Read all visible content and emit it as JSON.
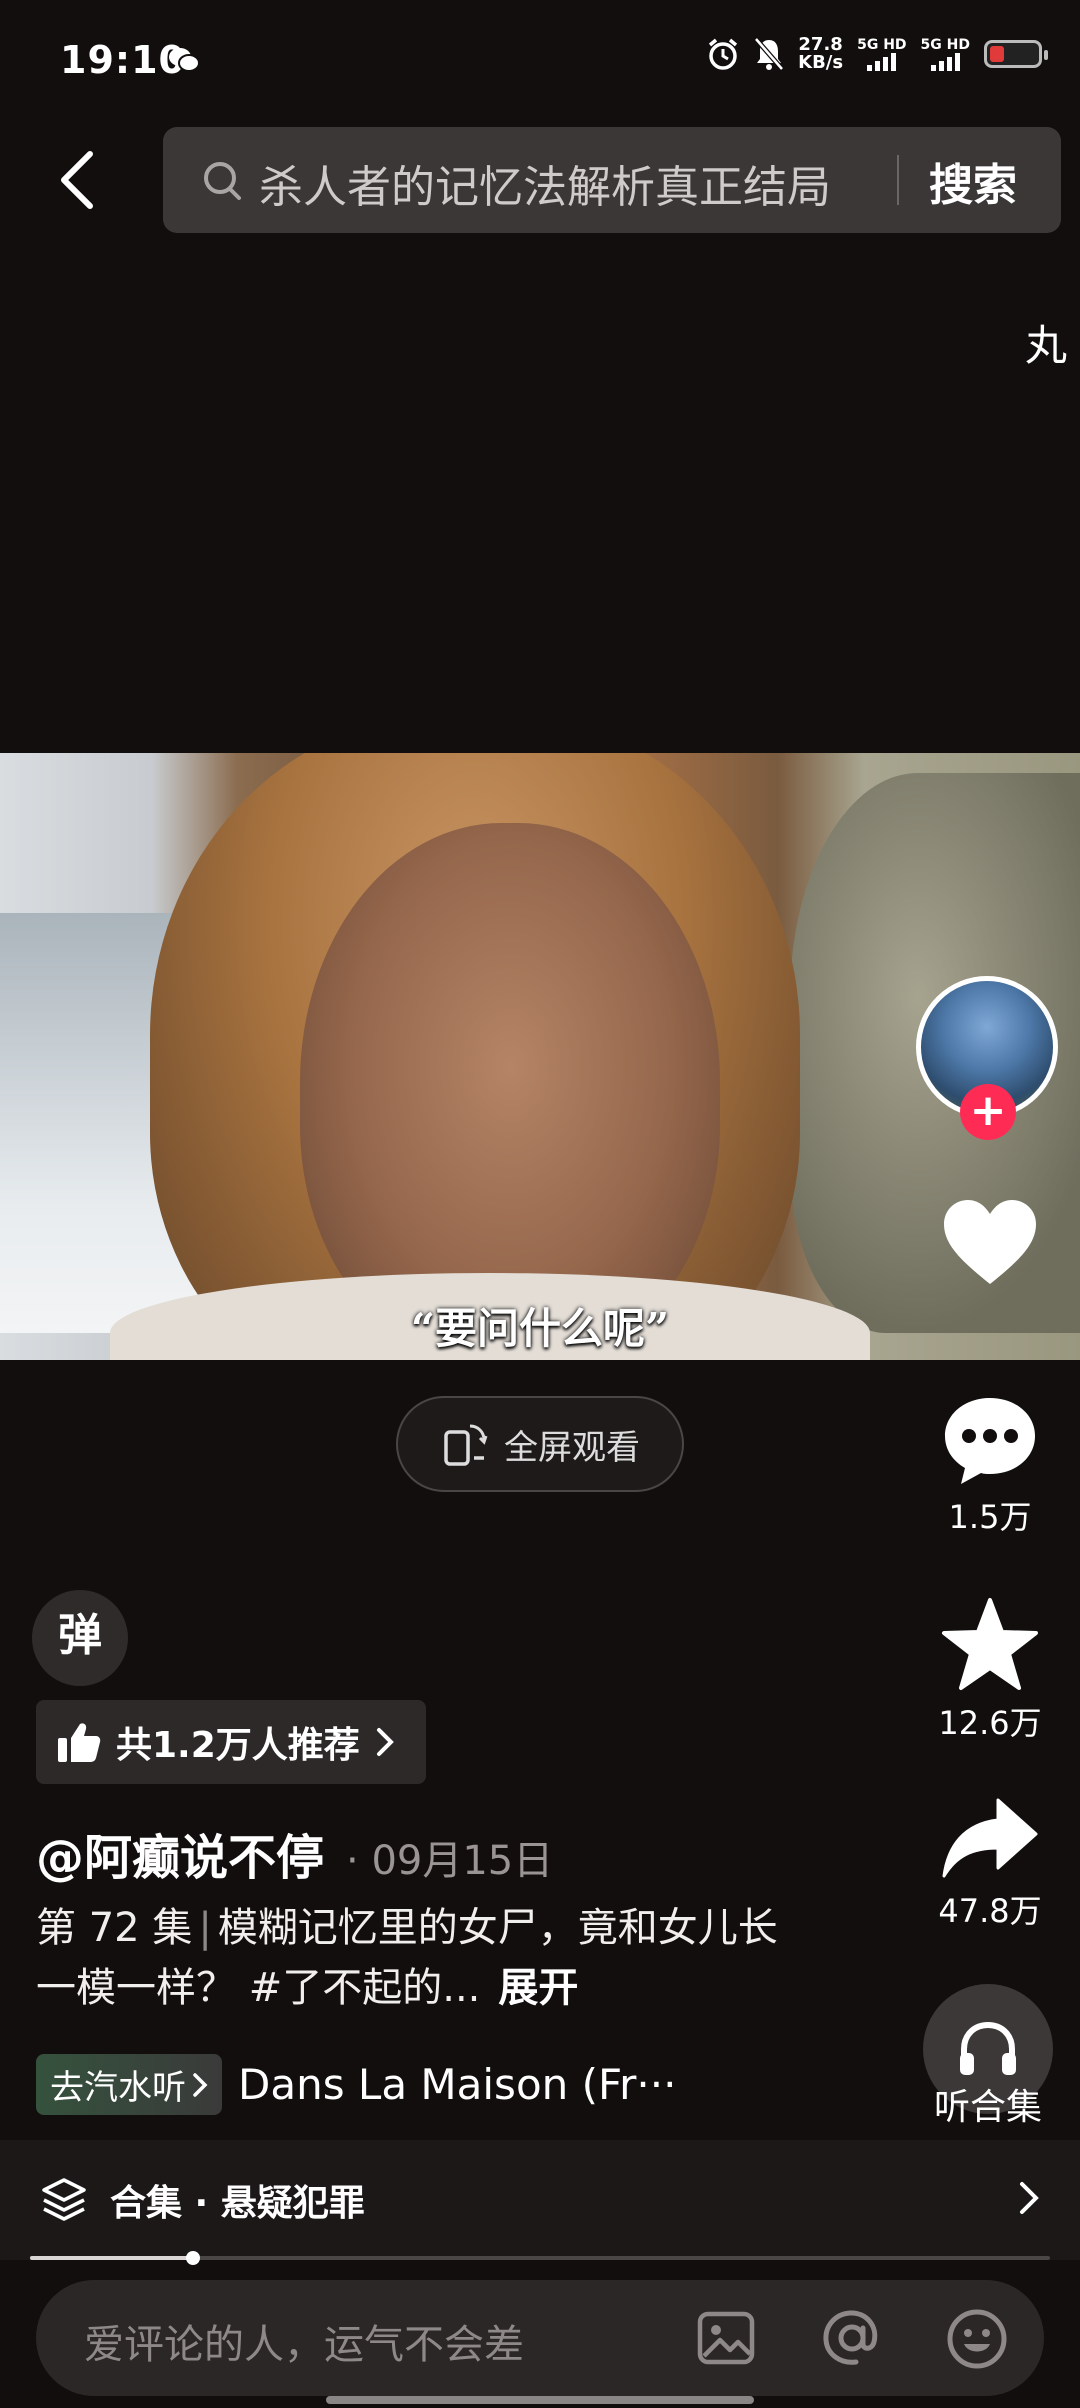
{
  "status_bar": {
    "time": "19:10",
    "net_speed_value": "27.8",
    "net_speed_unit": "KB/s",
    "sim1": "5G HD",
    "sim2": "5G HD"
  },
  "search": {
    "query": "杀人者的记忆法解析真正结局",
    "button": "搜索"
  },
  "edge_text": "丸",
  "video": {
    "subtitle": "“要问什么呢”",
    "fullscreen_label": "全屏观看"
  },
  "rail": {
    "comments": "1.5万",
    "favorites": "12.6万",
    "shares": "47.8万",
    "listen": "听合集"
  },
  "danmaku_label": "弹",
  "recommend": {
    "label": "共1.2万人推荐"
  },
  "post": {
    "author": "@阿癫说不停",
    "date": "· 09月15日",
    "episode": "第 72 集",
    "separator": "|",
    "description": "模糊记忆里的女尸，竟和女儿长一模一样？ #了不起的...",
    "expand": "展开"
  },
  "music": {
    "tag": "去汽水听",
    "song": "Dans La Maison (Fr···"
  },
  "collection": {
    "label": "合集 · 悬疑犯罪"
  },
  "playback": {
    "progress": 0.16
  },
  "comment_bar": {
    "placeholder": "爱评论的人，运气不会差"
  },
  "colors": {
    "accent": "#fe2c55",
    "background": "#120e0d"
  }
}
